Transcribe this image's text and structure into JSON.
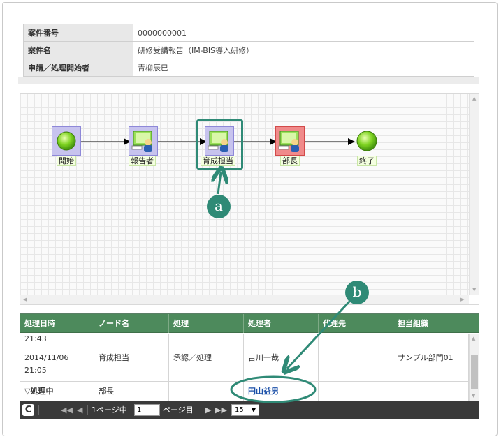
{
  "info": {
    "rows": [
      {
        "key": "案件番号",
        "value": "0000000001"
      },
      {
        "key": "案件名",
        "value": "研修受講報告（IM-BIS導入研修）"
      },
      {
        "key": "申請／処理開始者",
        "value": "青柳辰巳"
      }
    ]
  },
  "flow": {
    "nodes": [
      {
        "label": "開始",
        "icon": "start-node-icon"
      },
      {
        "label": "報告者",
        "icon": "user-task-icon"
      },
      {
        "label": "育成担当",
        "icon": "user-task-icon"
      },
      {
        "label": "部長",
        "icon": "user-task-icon"
      },
      {
        "label": "終了",
        "icon": "end-node-icon"
      }
    ]
  },
  "callouts": {
    "a": "a",
    "b": "b"
  },
  "history": {
    "columns": [
      "処理日時",
      "ノード名",
      "処理",
      "処理者",
      "代理先",
      "担当組織"
    ],
    "partial_row": {
      "date": "21:43"
    },
    "row1": {
      "date_line1": "2014/11/06",
      "date_line2": "21:05",
      "node": "育成担当",
      "action": "承認／処理",
      "user": "吉川一哉",
      "proxy": "",
      "org": "サンプル部門01"
    },
    "row2": {
      "date": "▽処理中",
      "node": "部長",
      "action": "",
      "user": "円山益男",
      "proxy": "",
      "org": ""
    }
  },
  "pager": {
    "refresh": "C",
    "page_prefix": "1ページ中",
    "page_value": "1",
    "page_suffix": "ページ目",
    "per_page": "15"
  },
  "colors": {
    "accent": "#2f8a76",
    "header_green": "#4d8a5c",
    "link_blue": "#1a4fa8"
  }
}
